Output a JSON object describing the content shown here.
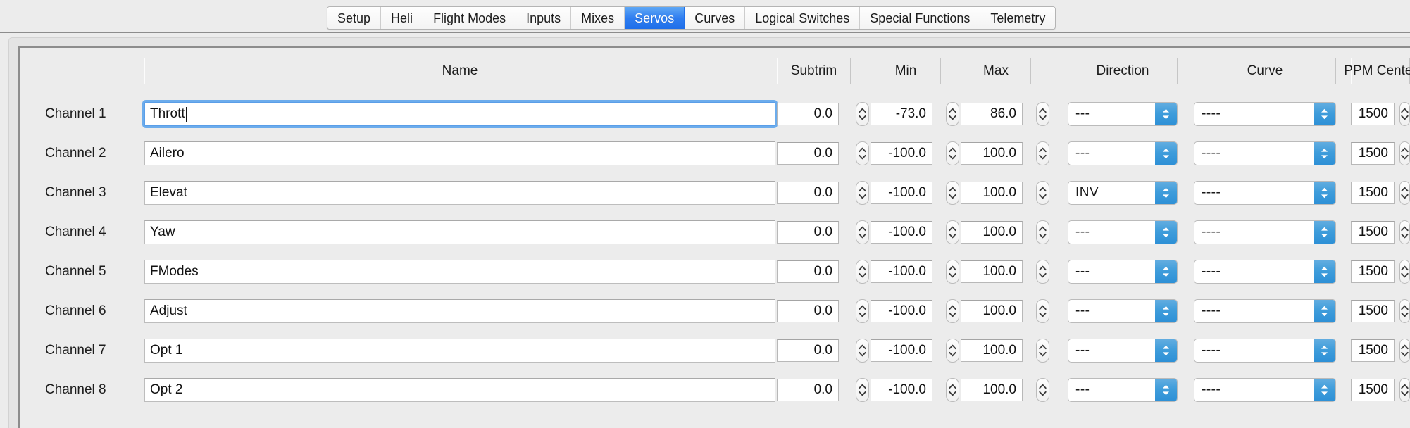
{
  "window": {
    "title": "Servos"
  },
  "tabs": [
    {
      "label": "Setup",
      "selected": false
    },
    {
      "label": "Heli",
      "selected": false
    },
    {
      "label": "Flight Modes",
      "selected": false
    },
    {
      "label": "Inputs",
      "selected": false
    },
    {
      "label": "Mixes",
      "selected": false
    },
    {
      "label": "Servos",
      "selected": true
    },
    {
      "label": "Curves",
      "selected": false
    },
    {
      "label": "Logical Switches",
      "selected": false
    },
    {
      "label": "Special Functions",
      "selected": false
    },
    {
      "label": "Telemetry",
      "selected": false
    }
  ],
  "columns": {
    "name": "Name",
    "subtrim": "Subtrim",
    "min": "Min",
    "max": "Max",
    "direction": "Direction",
    "curve": "Curve",
    "ppm_center": "PPM Center"
  },
  "rows": [
    {
      "channel": "Channel 1",
      "name": "Thrott",
      "focused": true,
      "subtrim": "0.0",
      "min": "-73.0",
      "max": "86.0",
      "direction": "---",
      "curve": "----",
      "ppm_center": "1500"
    },
    {
      "channel": "Channel 2",
      "name": "Ailero",
      "focused": false,
      "subtrim": "0.0",
      "min": "-100.0",
      "max": "100.0",
      "direction": "---",
      "curve": "----",
      "ppm_center": "1500"
    },
    {
      "channel": "Channel 3",
      "name": "Elevat",
      "focused": false,
      "subtrim": "0.0",
      "min": "-100.0",
      "max": "100.0",
      "direction": "INV",
      "curve": "----",
      "ppm_center": "1500"
    },
    {
      "channel": "Channel 4",
      "name": "Yaw",
      "focused": false,
      "subtrim": "0.0",
      "min": "-100.0",
      "max": "100.0",
      "direction": "---",
      "curve": "----",
      "ppm_center": "1500"
    },
    {
      "channel": "Channel 5",
      "name": "FModes",
      "focused": false,
      "subtrim": "0.0",
      "min": "-100.0",
      "max": "100.0",
      "direction": "---",
      "curve": "----",
      "ppm_center": "1500"
    },
    {
      "channel": "Channel 6",
      "name": "Adjust",
      "focused": false,
      "subtrim": "0.0",
      "min": "-100.0",
      "max": "100.0",
      "direction": "---",
      "curve": "----",
      "ppm_center": "1500"
    },
    {
      "channel": "Channel 7",
      "name": "Opt 1",
      "focused": false,
      "subtrim": "0.0",
      "min": "-100.0",
      "max": "100.0",
      "direction": "---",
      "curve": "----",
      "ppm_center": "1500"
    },
    {
      "channel": "Channel 8",
      "name": "Opt 2",
      "focused": false,
      "subtrim": "0.0",
      "min": "-100.0",
      "max": "100.0",
      "direction": "---",
      "curve": "----",
      "ppm_center": "1500"
    }
  ],
  "colors": {
    "accent": "#2f7df0",
    "combo_button": "#3f9ddb",
    "focus_ring": "#56a1ec",
    "window_bg": "#ececec",
    "panel_bg": "#e4e4e4"
  },
  "icons": {
    "stepper_up": "chevron-up-icon",
    "stepper_down": "chevron-down-icon",
    "combo_arrows": "chevron-updown-icon"
  }
}
